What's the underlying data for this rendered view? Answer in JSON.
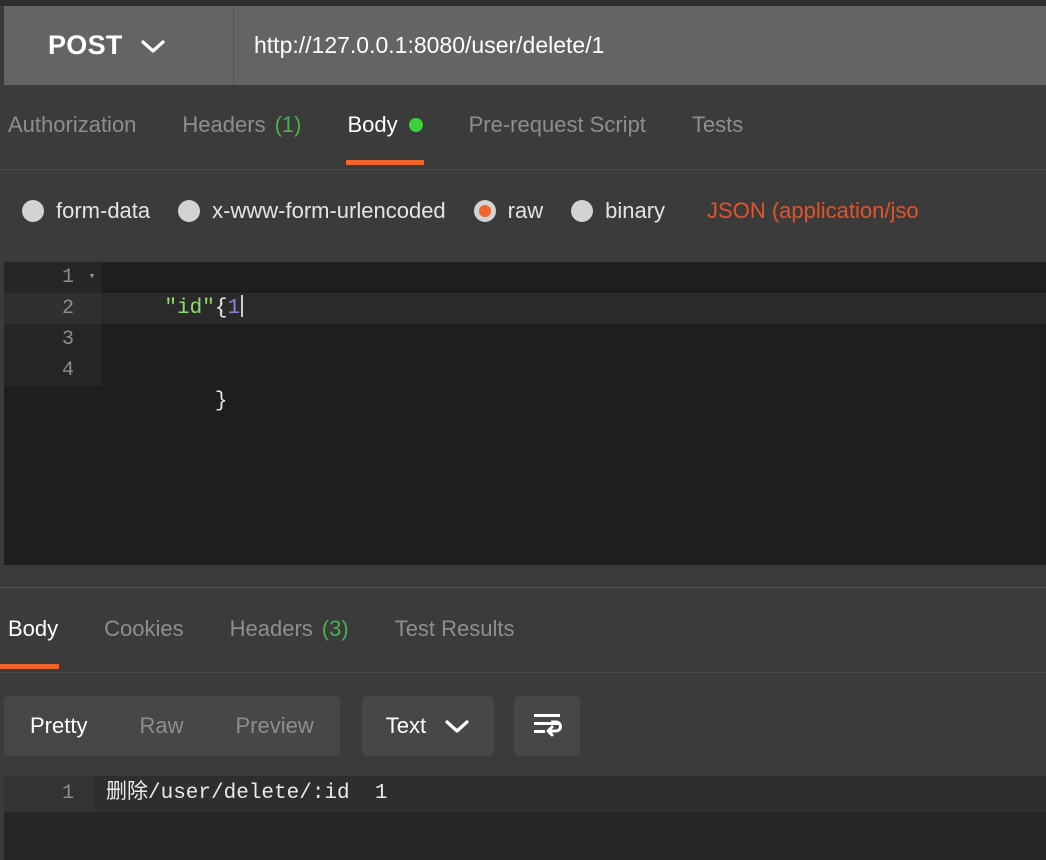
{
  "request_bar": {
    "method": "POST",
    "method_chevron_icon": "chevron-down-icon",
    "url": "http://127.0.0.1:8080/user/delete/1"
  },
  "request_tabs": [
    {
      "label": "Authorization",
      "active": false,
      "count": ""
    },
    {
      "label": "Headers",
      "active": false,
      "count": "(1)"
    },
    {
      "label": "Body",
      "active": true,
      "count": "",
      "dot": true
    },
    {
      "label": "Pre-request Script",
      "active": false,
      "count": ""
    },
    {
      "label": "Tests",
      "active": false,
      "count": ""
    }
  ],
  "body_types": {
    "options": [
      {
        "label": "form-data",
        "selected": false
      },
      {
        "label": "x-www-form-urlencoded",
        "selected": false
      },
      {
        "label": "raw",
        "selected": true
      },
      {
        "label": "binary",
        "selected": false
      }
    ],
    "content_type": "JSON (application/jso"
  },
  "request_editor": {
    "lines": [
      {
        "num": "1",
        "fold": "▾",
        "text": "{",
        "highlight": false
      },
      {
        "num": "2",
        "fold": "",
        "text": "\"id\":1",
        "highlight": true
      },
      {
        "num": "3",
        "fold": "",
        "text": "",
        "highlight": false
      },
      {
        "num": "4",
        "fold": "",
        "text": "}",
        "highlight": false
      }
    ],
    "line1_text": "{",
    "line2_key": "\"id\"",
    "line2_colon": ":",
    "line2_value": "1",
    "line4_text": "}"
  },
  "response_tabs": [
    {
      "label": "Body",
      "active": true,
      "count": ""
    },
    {
      "label": "Cookies",
      "active": false,
      "count": ""
    },
    {
      "label": "Headers",
      "active": false,
      "count": "(3)"
    },
    {
      "label": "Test Results",
      "active": false,
      "count": ""
    }
  ],
  "response_toolbar": {
    "view_modes": [
      {
        "label": "Pretty",
        "active": true
      },
      {
        "label": "Raw",
        "active": false
      },
      {
        "label": "Preview",
        "active": false
      }
    ],
    "format_label": "Text",
    "format_chevron_icon": "chevron-down-icon",
    "wrap_icon": "word-wrap-icon"
  },
  "response_body": {
    "line_number": "1",
    "text": "删除/user/delete/:id  1"
  },
  "colors": {
    "accent": "#f1652a",
    "count_green": "#4caf50",
    "dot_green": "#3dd13d",
    "content_type": "#e2552a",
    "url_bar": "#646464",
    "panel_bg": "#3b3b3b",
    "editor_bg": "#1e1e1e"
  }
}
